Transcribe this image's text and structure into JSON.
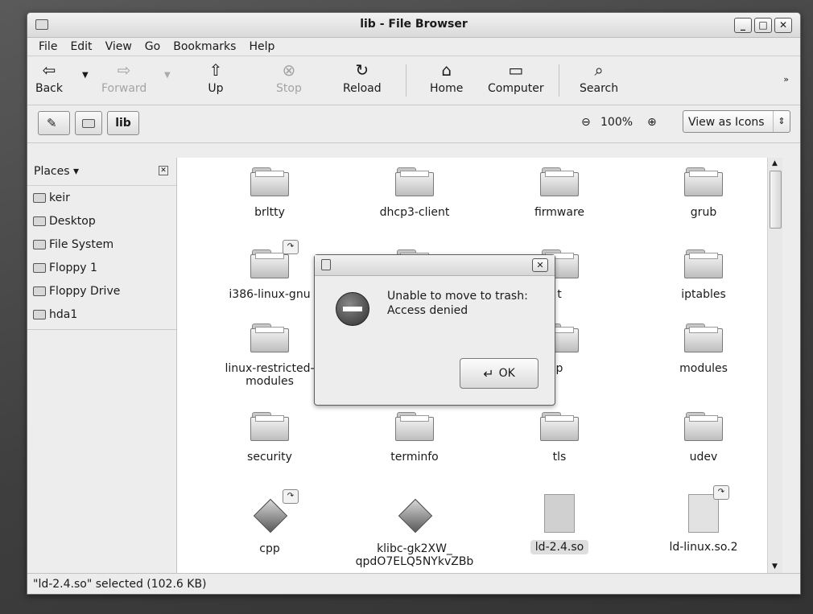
{
  "window": {
    "title": "lib - File Browser"
  },
  "menubar": [
    "File",
    "Edit",
    "View",
    "Go",
    "Bookmarks",
    "Help"
  ],
  "toolbar": {
    "back": "Back",
    "forward": "Forward",
    "up": "Up",
    "stop": "Stop",
    "reload": "Reload",
    "home": "Home",
    "computer": "Computer",
    "search": "Search"
  },
  "location": {
    "current": "lib",
    "zoom": "100%",
    "view_mode": "View as Icons"
  },
  "sidebar": {
    "header": "Places",
    "items": [
      "keir",
      "Desktop",
      "File System",
      "Floppy 1",
      "Floppy Drive",
      "hda1"
    ]
  },
  "files": [
    {
      "name": "brltty",
      "kind": "folder"
    },
    {
      "name": "dhcp3-client",
      "kind": "folder"
    },
    {
      "name": "firmware",
      "kind": "folder"
    },
    {
      "name": "grub",
      "kind": "folder"
    },
    {
      "name": "i386-linux-gnu",
      "kind": "folder-link"
    },
    {
      "name": "",
      "kind": "folder"
    },
    {
      "name": "t",
      "kind": "folder"
    },
    {
      "name": "iptables",
      "kind": "folder"
    },
    {
      "name": "linux-restricted-modules",
      "kind": "folder"
    },
    {
      "name": "",
      "kind": "folder"
    },
    {
      "name": "p",
      "kind": "folder"
    },
    {
      "name": "modules",
      "kind": "folder"
    },
    {
      "name": "security",
      "kind": "folder"
    },
    {
      "name": "terminfo",
      "kind": "folder"
    },
    {
      "name": "tls",
      "kind": "folder"
    },
    {
      "name": "udev",
      "kind": "folder"
    },
    {
      "name": "cpp",
      "kind": "executable-link"
    },
    {
      "name": "klibc-gk2XW_ qpdO7ELQ5NYkvZBb",
      "kind": "executable"
    },
    {
      "name": "ld-2.4.so",
      "kind": "file-selected"
    },
    {
      "name": "ld-linux.so.2",
      "kind": "file-link"
    }
  ],
  "status": "\"ld-2.4.so\" selected (102.6 KB)",
  "dialog": {
    "message_line1": "Unable to move to trash:",
    "message_line2": "Access denied",
    "ok_label": "OK"
  }
}
